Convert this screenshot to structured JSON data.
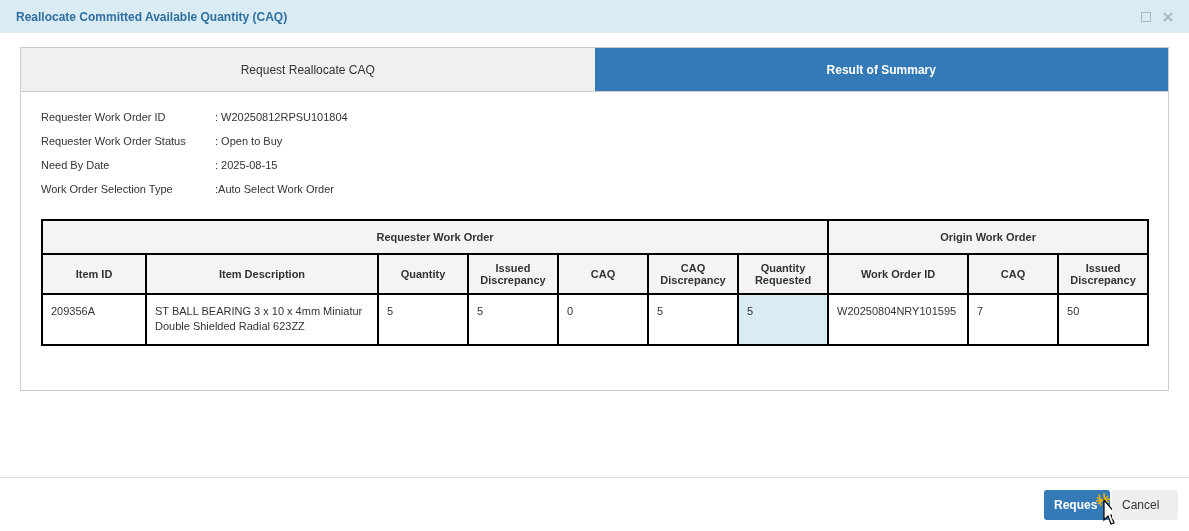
{
  "window": {
    "title": "Reallocate Committed Available Quantity (CAQ)"
  },
  "tabs": [
    {
      "label": "Request Reallocate CAQ",
      "selected": false
    },
    {
      "label": "Result of Summary",
      "selected": true
    }
  ],
  "details": [
    {
      "label": "Requester Work Order ID",
      "value": ": W20250812RPSU101804"
    },
    {
      "label": "Requester Work Order Status",
      "value": ": Open to Buy"
    },
    {
      "label": "Need By Date",
      "value": ": 2025-08-15"
    },
    {
      "label": "Work Order Selection Type",
      "value": ":Auto Select Work Order"
    }
  ],
  "table": {
    "groups": [
      {
        "label": "Requester Work Order",
        "columns": [
          "Item ID",
          "Item Description",
          "Quantity",
          "Issued Discrepancy",
          "CAQ",
          "CAQ Discrepancy",
          "Quantity Requested"
        ]
      },
      {
        "label": "Origin Work Order",
        "columns": [
          "Work Order ID",
          "CAQ",
          "Issued Discrepancy"
        ]
      }
    ],
    "rows": [
      {
        "cells": [
          {
            "text": "209356A",
            "highlighted": false
          },
          {
            "text": "ST BALL BEARING 3 x 10 x 4mm Miniatur Double Shielded Radial 623ZZ",
            "highlighted": false
          },
          {
            "text": "5",
            "highlighted": false
          },
          {
            "text": "5",
            "highlighted": false
          },
          {
            "text": "0",
            "highlighted": false
          },
          {
            "text": "5",
            "highlighted": false
          },
          {
            "text": "5",
            "highlighted": true
          },
          {
            "text": "W20250804NRY101595",
            "highlighted": false
          },
          {
            "text": "7",
            "highlighted": false
          },
          {
            "text": "50",
            "highlighted": false
          }
        ]
      }
    ]
  },
  "buttons": [
    {
      "label": "Reques",
      "kind": "primary"
    },
    {
      "label": "Cancel",
      "kind": "secondary"
    }
  ]
}
